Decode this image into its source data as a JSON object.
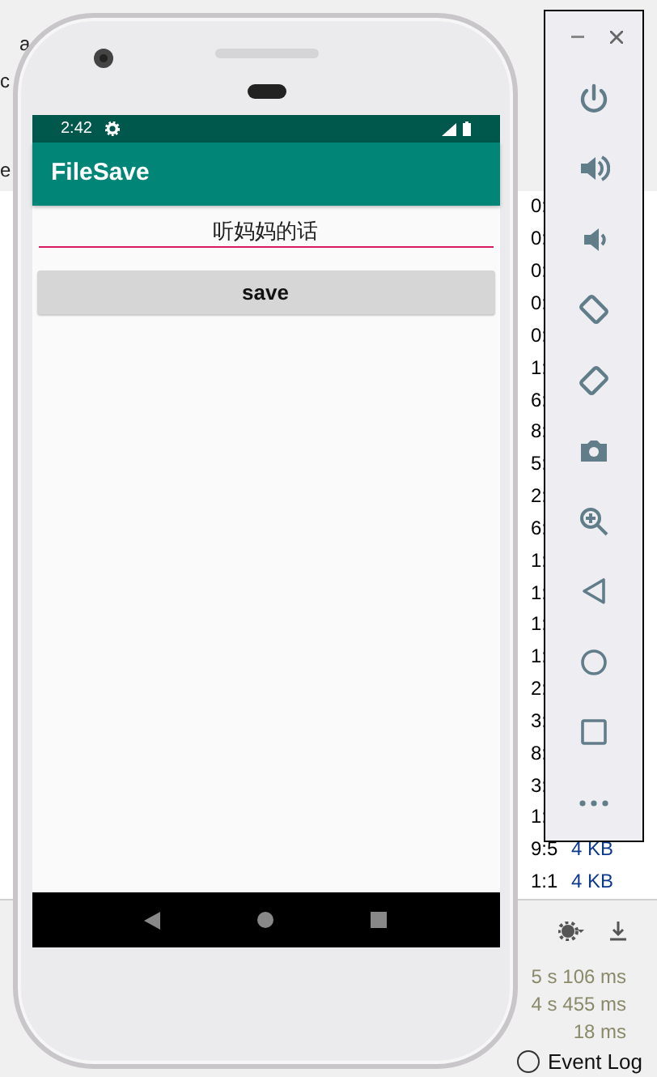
{
  "ide": {
    "left_fragments": [
      "a",
      "c",
      "e"
    ],
    "list_rows": [
      {
        "time": "0:"
      },
      {
        "time": "0:"
      },
      {
        "time": "0:"
      },
      {
        "time": "0:"
      },
      {
        "time": "0:"
      },
      {
        "time": "1:"
      },
      {
        "time": "6:"
      },
      {
        "time": "8:"
      },
      {
        "time": "5:"
      },
      {
        "time": "2:"
      },
      {
        "time": "6:"
      },
      {
        "time": "1:"
      },
      {
        "time": "1:"
      },
      {
        "time": "1:"
      },
      {
        "time": "1:"
      },
      {
        "time": "2:"
      },
      {
        "time": "3:"
      },
      {
        "time": "8:"
      },
      {
        "time": "3:"
      },
      {
        "time": "1:"
      },
      {
        "time": "9:5",
        "size": "4 KB"
      },
      {
        "time": "1:1",
        "size": "4 KB"
      }
    ],
    "timings": [
      "5 s 106 ms",
      "4 s 455 ms",
      "18 ms"
    ],
    "event_log": "Event Log"
  },
  "phone": {
    "status_bar": {
      "time": "2:42"
    },
    "app_bar": {
      "title": "FileSave"
    },
    "text_field": {
      "value": "听妈妈的话"
    },
    "button": {
      "label": "save"
    }
  }
}
